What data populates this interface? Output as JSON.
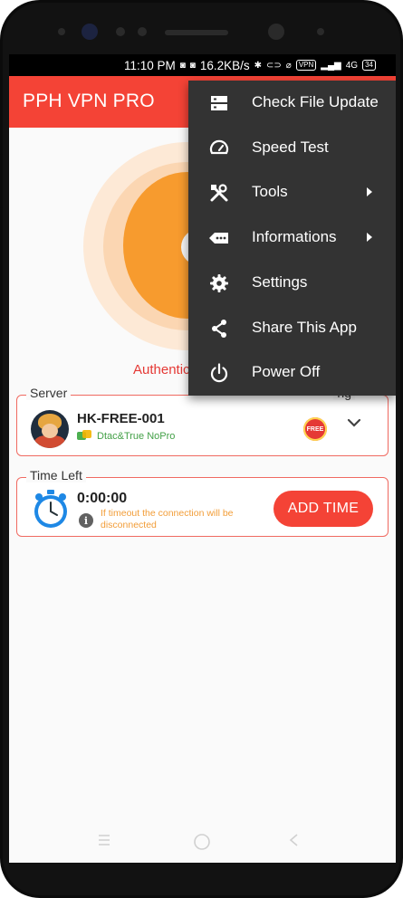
{
  "status_bar": {
    "time": "11:10 PM",
    "speed": "16.2KB/s",
    "vpn_badge": "VPN",
    "network": "4G",
    "battery": "34"
  },
  "toolbar": {
    "title": "PPH VPN PRO"
  },
  "connect": {
    "status": "Authenticating"
  },
  "server_card": {
    "label": "Server",
    "right_label": "ng",
    "name": "HK-FREE-001",
    "subtitle": "Dtac&True NoPro",
    "badge": "FREE"
  },
  "time_card": {
    "label": "Time Left",
    "value": "0:00:00",
    "note": "If timeout the connection will be disconnected",
    "button": "ADD TIME"
  },
  "menu": {
    "items": [
      {
        "label": "Check File Update",
        "icon": "file-update-icon",
        "submenu": false
      },
      {
        "label": "Speed Test",
        "icon": "speedometer-icon",
        "submenu": false
      },
      {
        "label": "Tools",
        "icon": "tools-icon",
        "submenu": true
      },
      {
        "label": "Informations",
        "icon": "info-tag-icon",
        "submenu": true
      },
      {
        "label": "Settings",
        "icon": "gear-icon",
        "submenu": false
      },
      {
        "label": "Share This App",
        "icon": "share-icon",
        "submenu": false
      },
      {
        "label": "Power Off",
        "icon": "power-icon",
        "submenu": false
      }
    ]
  },
  "colors": {
    "primary": "#f44336",
    "menu_bg": "#333333",
    "connect_orange": "#f79b2e",
    "accent_green": "#43a047",
    "note_orange": "#f29d38"
  }
}
